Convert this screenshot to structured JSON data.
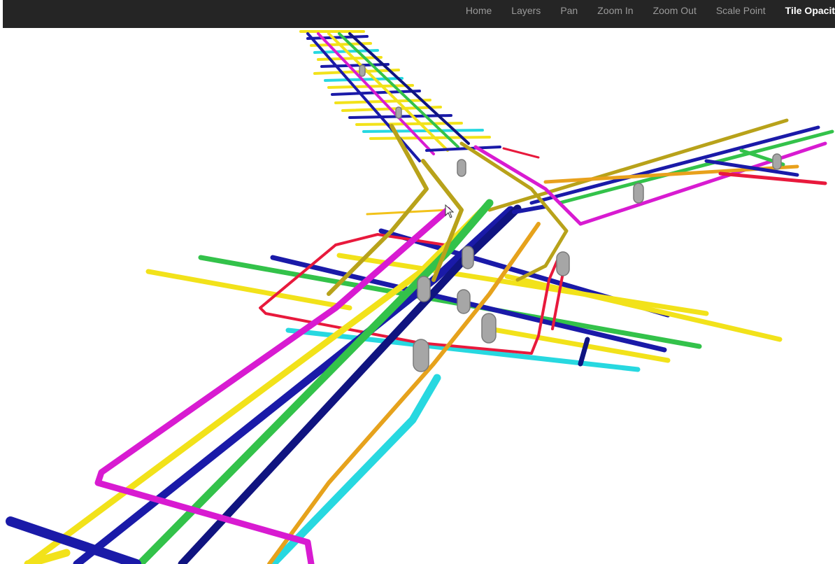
{
  "nav": {
    "items": [
      {
        "label": "Home"
      },
      {
        "label": "Layers"
      },
      {
        "label": "Pan"
      },
      {
        "label": "Zoom In"
      },
      {
        "label": "Zoom Out"
      },
      {
        "label": "Scale Point"
      },
      {
        "label": "Tile Opacit",
        "active": true
      }
    ]
  },
  "colors": {
    "navbar_bg": "#252525",
    "nav_text": "#9a9a9a",
    "nav_active": "#ffffff",
    "pipe_yellow": "#f2e21a",
    "pipe_blue": "#1a1aa8",
    "pipe_navy": "#101480",
    "pipe_green": "#33c24a",
    "pipe_magenta": "#d81bd1",
    "pipe_cyan": "#27d8e0",
    "pipe_red": "#e8193c",
    "pipe_orange": "#e6a21c",
    "pipe_olive": "#b8a21a",
    "manhole_gray": "#a6a6a6"
  },
  "scene": {
    "description_icons": [
      "manhole-icon",
      "mouse-cursor-icon"
    ]
  }
}
